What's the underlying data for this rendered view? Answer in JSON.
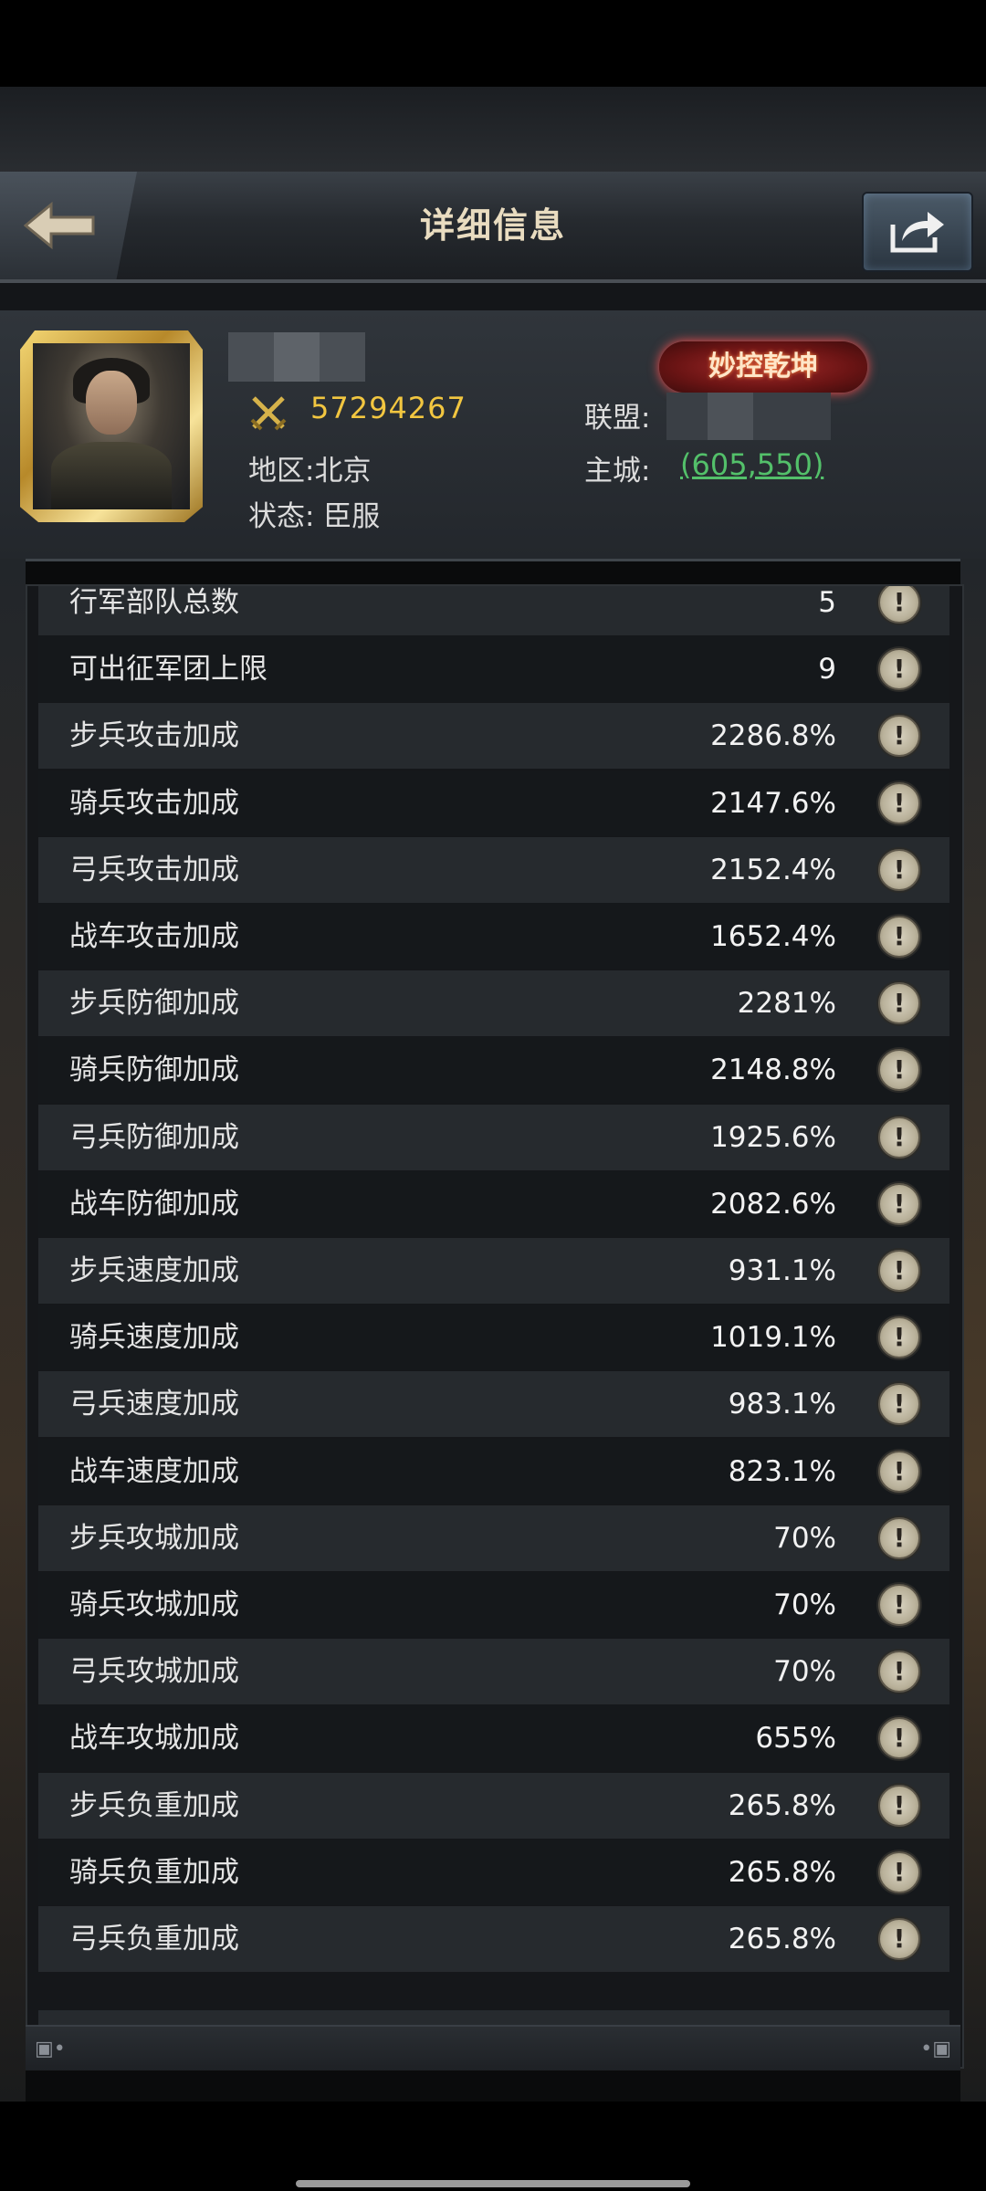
{
  "header": {
    "title": "详细信息",
    "back_icon": "back-arrow-icon",
    "share_icon": "share-icon"
  },
  "profile": {
    "power": "57294267",
    "region": "地区:北京",
    "state": "状态:  臣服",
    "alliance_label": "联盟:",
    "city_label": "主城:",
    "city_coords": "(605,550)",
    "badge": "妙控乾坤",
    "power_icon": "crossed-swords-icon"
  },
  "stats": [
    {
      "label": "行军部队总数",
      "value": "5"
    },
    {
      "label": "可出征军团上限",
      "value": "9"
    },
    {
      "label": "步兵攻击加成",
      "value": "2286.8%"
    },
    {
      "label": "骑兵攻击加成",
      "value": "2147.6%"
    },
    {
      "label": "弓兵攻击加成",
      "value": "2152.4%"
    },
    {
      "label": "战车攻击加成",
      "value": "1652.4%"
    },
    {
      "label": "步兵防御加成",
      "value": "2281%"
    },
    {
      "label": "骑兵防御加成",
      "value": "2148.8%"
    },
    {
      "label": "弓兵防御加成",
      "value": "1925.6%"
    },
    {
      "label": "战车防御加成",
      "value": "2082.6%"
    },
    {
      "label": "步兵速度加成",
      "value": "931.1%"
    },
    {
      "label": "骑兵速度加成",
      "value": "1019.1%"
    },
    {
      "label": "弓兵速度加成",
      "value": "983.1%"
    },
    {
      "label": "战车速度加成",
      "value": "823.1%"
    },
    {
      "label": "步兵攻城加成",
      "value": "70%"
    },
    {
      "label": "骑兵攻城加成",
      "value": "70%"
    },
    {
      "label": "弓兵攻城加成",
      "value": "70%"
    },
    {
      "label": "战车攻城加成",
      "value": "655%"
    },
    {
      "label": "步兵负重加成",
      "value": "265.8%"
    },
    {
      "label": "骑兵负重加成",
      "value": "265.8%"
    },
    {
      "label": "弓兵负重加成",
      "value": "265.8%"
    }
  ],
  "info_icon_name": "info-exclamation-icon",
  "info_glyph": "!"
}
